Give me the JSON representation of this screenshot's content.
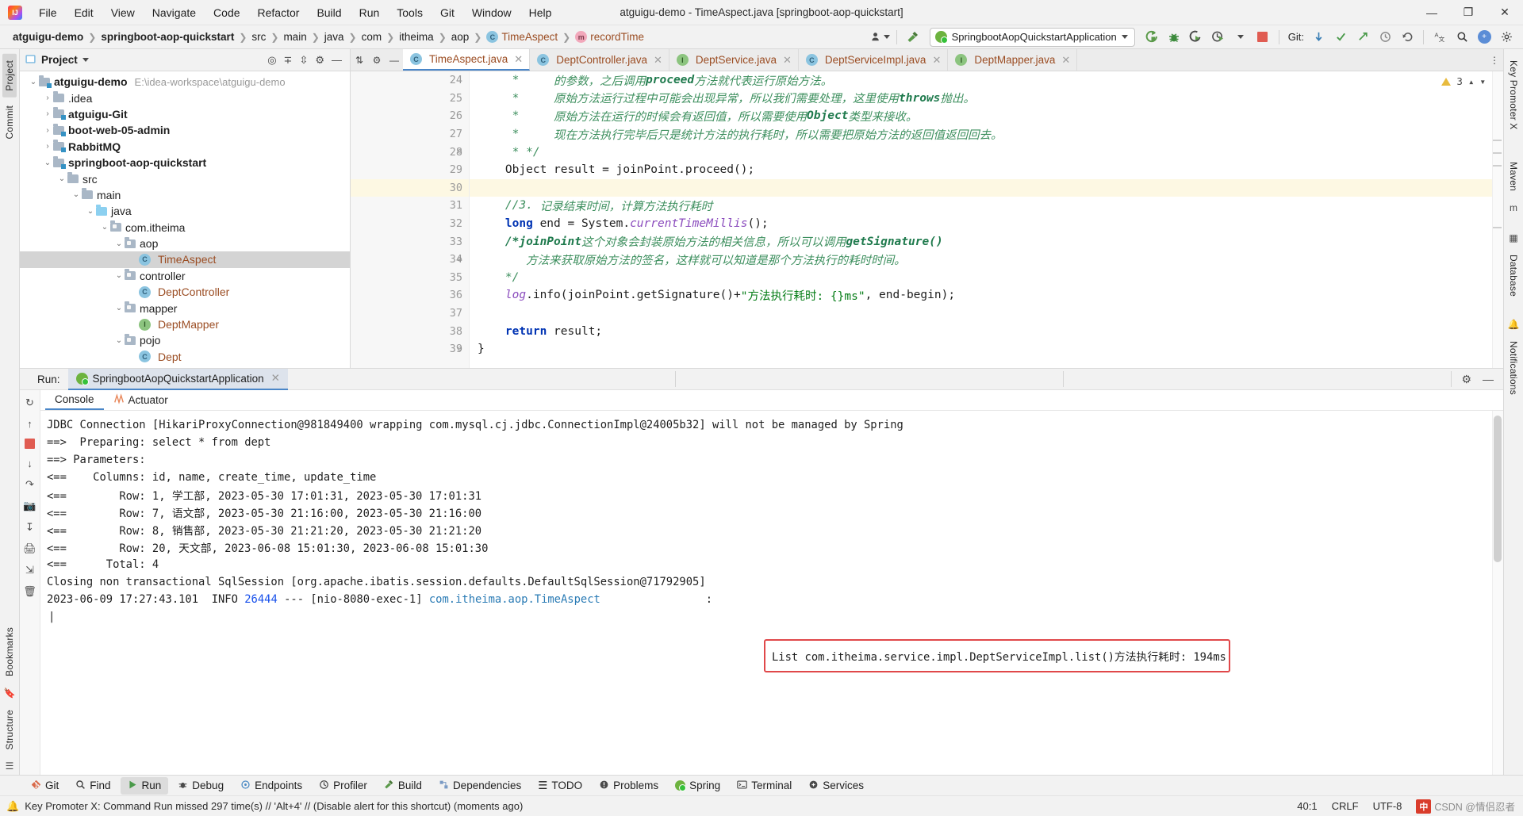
{
  "window": {
    "title": "atguigu-demo - TimeAspect.java [springboot-aop-quickstart]",
    "logo_text": "IJ",
    "minimize": "—",
    "maximize": "❐",
    "close": "✕"
  },
  "menubar": [
    {
      "label": "File"
    },
    {
      "label": "Edit"
    },
    {
      "label": "View"
    },
    {
      "label": "Navigate"
    },
    {
      "label": "Code"
    },
    {
      "label": "Refactor"
    },
    {
      "label": "Build"
    },
    {
      "label": "Run"
    },
    {
      "label": "Tools"
    },
    {
      "label": "Git"
    },
    {
      "label": "Window"
    },
    {
      "label": "Help"
    }
  ],
  "breadcrumbs": [
    {
      "label": "atguigu-demo",
      "bold": true,
      "icon": ""
    },
    {
      "label": "springboot-aop-quickstart",
      "bold": true,
      "icon": ""
    },
    {
      "label": "src",
      "bold": false,
      "icon": ""
    },
    {
      "label": "main",
      "bold": false,
      "icon": ""
    },
    {
      "label": "java",
      "bold": false,
      "icon": ""
    },
    {
      "label": "com",
      "bold": false,
      "icon": ""
    },
    {
      "label": "itheima",
      "bold": false,
      "icon": ""
    },
    {
      "label": "aop",
      "bold": false,
      "icon": ""
    },
    {
      "label": "TimeAspect",
      "bold": false,
      "icon": "c"
    },
    {
      "label": "recordTime",
      "bold": false,
      "icon": "m"
    }
  ],
  "toolbar": {
    "run_config": "SpringbootAopQuickstartApplication",
    "git_label": "Git:",
    "icons": {
      "profile": "profile-icon",
      "hammer": "build-icon",
      "run": "run-icon",
      "debug": "debug-icon",
      "run_coverage": "run-with-coverage-icon",
      "profiler": "profiler-icon",
      "stop": "stop-icon",
      "update": "update-project-icon",
      "commit": "commit-icon",
      "push": "push-icon",
      "history": "history-icon",
      "rollback": "rollback-icon",
      "translate": "translate-icon",
      "search": "search-icon",
      "plugin": "plugin-icon",
      "settings": "settings-icon"
    }
  },
  "left_strip": [
    {
      "label": "Project",
      "selected": true
    },
    {
      "label": "Commit",
      "selected": false
    },
    {
      "label": "Bookmarks",
      "selected": false
    },
    {
      "label": "Structure",
      "selected": false
    }
  ],
  "right_strip": [
    {
      "label": "Key Promoter X",
      "selected": false
    },
    {
      "label": "Maven",
      "selected": false
    },
    {
      "label": "Database",
      "selected": false
    },
    {
      "label": "Notifications",
      "selected": false
    }
  ],
  "project_pane": {
    "title": "Project",
    "tree": [
      {
        "indent": 0,
        "chevron": "⌄",
        "icon": "module",
        "label": "atguigu-demo",
        "bold": true,
        "path": "E:\\idea-workspace\\atguigu-demo",
        "selected": false
      },
      {
        "indent": 1,
        "chevron": "›",
        "icon": "folder",
        "label": ".idea",
        "bold": false,
        "path": "",
        "selected": false
      },
      {
        "indent": 1,
        "chevron": "›",
        "icon": "module",
        "label": "atguigu-Git",
        "bold": true,
        "path": "",
        "selected": false
      },
      {
        "indent": 1,
        "chevron": "›",
        "icon": "module",
        "label": "boot-web-05-admin",
        "bold": true,
        "path": "",
        "selected": false
      },
      {
        "indent": 1,
        "chevron": "›",
        "icon": "module",
        "label": "RabbitMQ",
        "bold": true,
        "path": "",
        "selected": false
      },
      {
        "indent": 1,
        "chevron": "⌄",
        "icon": "module",
        "label": "springboot-aop-quickstart",
        "bold": true,
        "path": "",
        "selected": false
      },
      {
        "indent": 2,
        "chevron": "⌄",
        "icon": "folder",
        "label": "src",
        "bold": false,
        "path": "",
        "selected": false
      },
      {
        "indent": 3,
        "chevron": "⌄",
        "icon": "folder",
        "label": "main",
        "bold": false,
        "path": "",
        "selected": false
      },
      {
        "indent": 4,
        "chevron": "⌄",
        "icon": "source",
        "label": "java",
        "bold": false,
        "path": "",
        "selected": false
      },
      {
        "indent": 5,
        "chevron": "⌄",
        "icon": "package",
        "label": "com.itheima",
        "bold": false,
        "path": "",
        "selected": false
      },
      {
        "indent": 6,
        "chevron": "⌄",
        "icon": "package",
        "label": "aop",
        "bold": false,
        "path": "",
        "selected": false
      },
      {
        "indent": 7,
        "chevron": "",
        "icon": "class",
        "label": "TimeAspect",
        "bold": false,
        "path": "",
        "selected": true
      },
      {
        "indent": 6,
        "chevron": "⌄",
        "icon": "package",
        "label": "controller",
        "bold": false,
        "path": "",
        "selected": false
      },
      {
        "indent": 7,
        "chevron": "",
        "icon": "class",
        "label": "DeptController",
        "bold": false,
        "path": "",
        "selected": false
      },
      {
        "indent": 6,
        "chevron": "⌄",
        "icon": "package",
        "label": "mapper",
        "bold": false,
        "path": "",
        "selected": false
      },
      {
        "indent": 7,
        "chevron": "",
        "icon": "interface",
        "label": "DeptMapper",
        "bold": false,
        "path": "",
        "selected": false
      },
      {
        "indent": 6,
        "chevron": "⌄",
        "icon": "package",
        "label": "pojo",
        "bold": false,
        "path": "",
        "selected": false
      },
      {
        "indent": 7,
        "chevron": "",
        "icon": "class",
        "label": "Dept",
        "bold": false,
        "path": "",
        "selected": false
      }
    ]
  },
  "editor": {
    "tabs": [
      {
        "label": "TimeAspect.java",
        "icon": "class",
        "active": true
      },
      {
        "label": "DeptController.java",
        "icon": "class",
        "active": false
      },
      {
        "label": "DeptService.java",
        "icon": "interface",
        "active": false
      },
      {
        "label": "DeptServiceImpl.java",
        "icon": "class",
        "active": false
      },
      {
        "label": "DeptMapper.java",
        "icon": "interface",
        "active": false
      }
    ],
    "inspection_count": "3",
    "lines": [
      {
        "n": "24",
        "fold": "",
        "hl": false,
        "tokens": [
          {
            "t": "     *     ",
            "c": "cm"
          },
          {
            "t": "的参数，之后调用",
            "c": "cm"
          },
          {
            "t": "proceed",
            "c": "cm-b"
          },
          {
            "t": "方法就代表运行原始方法。",
            "c": "cm"
          }
        ]
      },
      {
        "n": "25",
        "fold": "",
        "hl": false,
        "tokens": [
          {
            "t": "     *     ",
            "c": "cm"
          },
          {
            "t": "原始方法运行过程中可能会出现异常，所以我们需要处理，这里使用",
            "c": "cm"
          },
          {
            "t": "throws",
            "c": "cm-b"
          },
          {
            "t": "抛出。",
            "c": "cm"
          }
        ]
      },
      {
        "n": "26",
        "fold": "",
        "hl": false,
        "tokens": [
          {
            "t": "     *     ",
            "c": "cm"
          },
          {
            "t": "原始方法在运行的时候会有返回值，所以需要使用",
            "c": "cm"
          },
          {
            "t": "Object",
            "c": "cm-b"
          },
          {
            "t": "类型来接收。",
            "c": "cm"
          }
        ]
      },
      {
        "n": "27",
        "fold": "",
        "hl": false,
        "tokens": [
          {
            "t": "     *     ",
            "c": "cm"
          },
          {
            "t": "现在方法执行完毕后只是统计方法的执行耗时，所以需要把原始方法的返回值返回回去。",
            "c": "cm"
          }
        ]
      },
      {
        "n": "28",
        "fold": "⊖",
        "hl": false,
        "tokens": [
          {
            "t": "     * */",
            "c": "cm"
          }
        ]
      },
      {
        "n": "29",
        "fold": "",
        "hl": false,
        "tokens": [
          {
            "t": "    Object",
            "c": "plain"
          },
          {
            "t": " result = joinPoint.proceed();",
            "c": "plain"
          }
        ]
      },
      {
        "n": "30",
        "fold": "",
        "hl": true,
        "tokens": [
          {
            "t": "",
            "c": "plain"
          }
        ]
      },
      {
        "n": "31",
        "fold": "",
        "hl": false,
        "tokens": [
          {
            "t": "    //3. ",
            "c": "cm"
          },
          {
            "t": "记录结束时间，计算方法执行耗时",
            "c": "cm"
          }
        ]
      },
      {
        "n": "32",
        "fold": "",
        "hl": false,
        "tokens": [
          {
            "t": "    long",
            "c": "kw"
          },
          {
            "t": " end = System.",
            "c": "plain"
          },
          {
            "t": "currentTimeMillis",
            "c": "fld"
          },
          {
            "t": "();",
            "c": "plain"
          }
        ]
      },
      {
        "n": "33",
        "fold": "⊖",
        "hl": false,
        "tokens": [
          {
            "t": "    /*joinPoint",
            "c": "cm-b"
          },
          {
            "t": "这个对象会封装原始方法的相关信息，所以可以调用",
            "c": "cm"
          },
          {
            "t": "getSignature()",
            "c": "cm-b"
          }
        ]
      },
      {
        "n": "34",
        "fold": "",
        "hl": false,
        "tokens": [
          {
            "t": "       ",
            "c": "cm"
          },
          {
            "t": "方法来获取原始方法的签名，这样就可以知道是那个方法执行的耗时时间。",
            "c": "cm"
          }
        ]
      },
      {
        "n": "35",
        "fold": "",
        "hl": false,
        "tokens": [
          {
            "t": "    */",
            "c": "cm"
          }
        ]
      },
      {
        "n": "36",
        "fold": "",
        "hl": false,
        "tokens": [
          {
            "t": "    log",
            "c": "fld"
          },
          {
            "t": ".info(joinPoint.getSignature()+",
            "c": "plain"
          },
          {
            "t": "\"方法执行耗时: {}ms\"",
            "c": "str"
          },
          {
            "t": ", end-begin);",
            "c": "plain"
          }
        ]
      },
      {
        "n": "37",
        "fold": "",
        "hl": false,
        "tokens": [
          {
            "t": "",
            "c": "plain"
          }
        ]
      },
      {
        "n": "38",
        "fold": "",
        "hl": false,
        "tokens": [
          {
            "t": "    return",
            "c": "kw"
          },
          {
            "t": " result;",
            "c": "plain"
          }
        ]
      },
      {
        "n": "39",
        "fold": "⊖",
        "hl": false,
        "tokens": [
          {
            "t": "}",
            "c": "plain"
          }
        ]
      }
    ]
  },
  "run_panel": {
    "label": "Run:",
    "tab": "SpringbootAopQuickstartApplication",
    "subtabs": [
      {
        "label": "Console",
        "active": true,
        "icon": ""
      },
      {
        "label": "Actuator",
        "active": false,
        "icon": "actuator-icon"
      }
    ],
    "console_lines": [
      "JDBC Connection [HikariProxyConnection@981849400 wrapping com.mysql.cj.jdbc.ConnectionImpl@24005b32] will not be managed by Spring",
      "==>  Preparing: select * from dept",
      "==> Parameters: ",
      "<==    Columns: id, name, create_time, update_time",
      "<==        Row: 1, 学工部, 2023-05-30 17:01:31, 2023-05-30 17:01:31",
      "<==        Row: 7, 语文部, 2023-05-30 21:16:00, 2023-05-30 21:16:00",
      "<==        Row: 8, 销售部, 2023-05-30 21:21:20, 2023-05-30 21:21:20",
      "<==        Row: 20, 天文部, 2023-06-08 15:01:30, 2023-06-08 15:01:30",
      "<==      Total: 4",
      "Closing non transactional SqlSession [org.apache.ibatis.session.defaults.DefaultSqlSession@71792905]"
    ],
    "log_line": {
      "timestamp": "2023-06-09 17:27:43.101",
      "level": "INFO",
      "pid": "26444",
      "dashes": "---",
      "thread": "[nio-8080-exec-1]",
      "logger": "com.itheima.aop.TimeAspect",
      "colon": ":",
      "message": "List com.itheima.service.impl.DeptServiceImpl.list()方法执行耗时: 194ms"
    },
    "highlight_color": "#e0484a"
  },
  "bottom_tools": [
    {
      "label": "Git",
      "icon": "git-icon",
      "selected": false
    },
    {
      "label": "Find",
      "icon": "search-icon",
      "selected": false
    },
    {
      "label": "Run",
      "icon": "run-icon",
      "selected": true
    },
    {
      "label": "Debug",
      "icon": "debug-icon",
      "selected": false
    },
    {
      "label": "Endpoints",
      "icon": "endpoints-icon",
      "selected": false
    },
    {
      "label": "Profiler",
      "icon": "profiler-icon",
      "selected": false
    },
    {
      "label": "Build",
      "icon": "build-icon",
      "selected": false
    },
    {
      "label": "Dependencies",
      "icon": "dependencies-icon",
      "selected": false
    },
    {
      "label": "TODO",
      "icon": "todo-icon",
      "selected": false
    },
    {
      "label": "Problems",
      "icon": "problems-icon",
      "selected": false
    },
    {
      "label": "Spring",
      "icon": "spring-icon",
      "selected": false
    },
    {
      "label": "Terminal",
      "icon": "terminal-icon",
      "selected": false
    },
    {
      "label": "Services",
      "icon": "services-icon",
      "selected": false
    }
  ],
  "statusbar": {
    "message": "Key Promoter X: Command Run missed 297 time(s) // 'Alt+4' // (Disable alert for this shortcut) (moments ago)",
    "caret": "40:1",
    "line_sep": "CRLF",
    "encoding": "UTF-8",
    "watermark_red": "中",
    "watermark_text": "CSDN @情侣忍者"
  }
}
